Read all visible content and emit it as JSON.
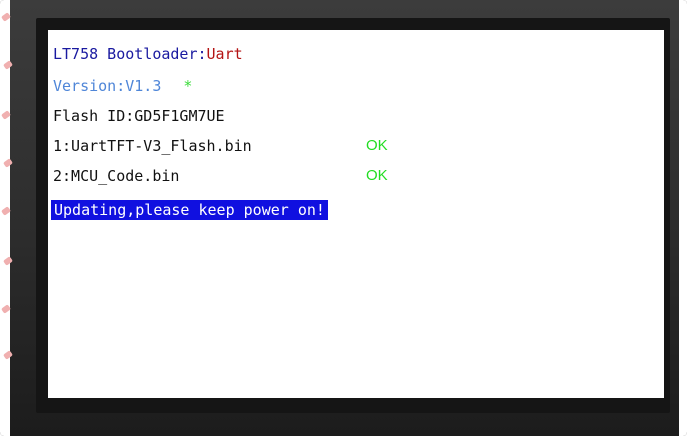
{
  "screen": {
    "title_label": "LT758 Bootloader:",
    "title_mode": "Uart",
    "version_text": "Version:V1.3",
    "status_dot": "*",
    "flash_id": "Flash ID:GD5F1GM7UE",
    "files": [
      {
        "name": "1:UartTFT-V3_Flash.bin",
        "status": "OK"
      },
      {
        "name": "2:MCU_Code.bin",
        "status": "OK"
      }
    ],
    "banner": "Updating,please keep power on!"
  },
  "colors": {
    "title_label": "#1a1aa0",
    "title_mode": "#b41414",
    "version": "#4f86d8",
    "ok": "#22dd22",
    "banner_bg": "#1010e0",
    "banner_text": "#ffffff"
  }
}
